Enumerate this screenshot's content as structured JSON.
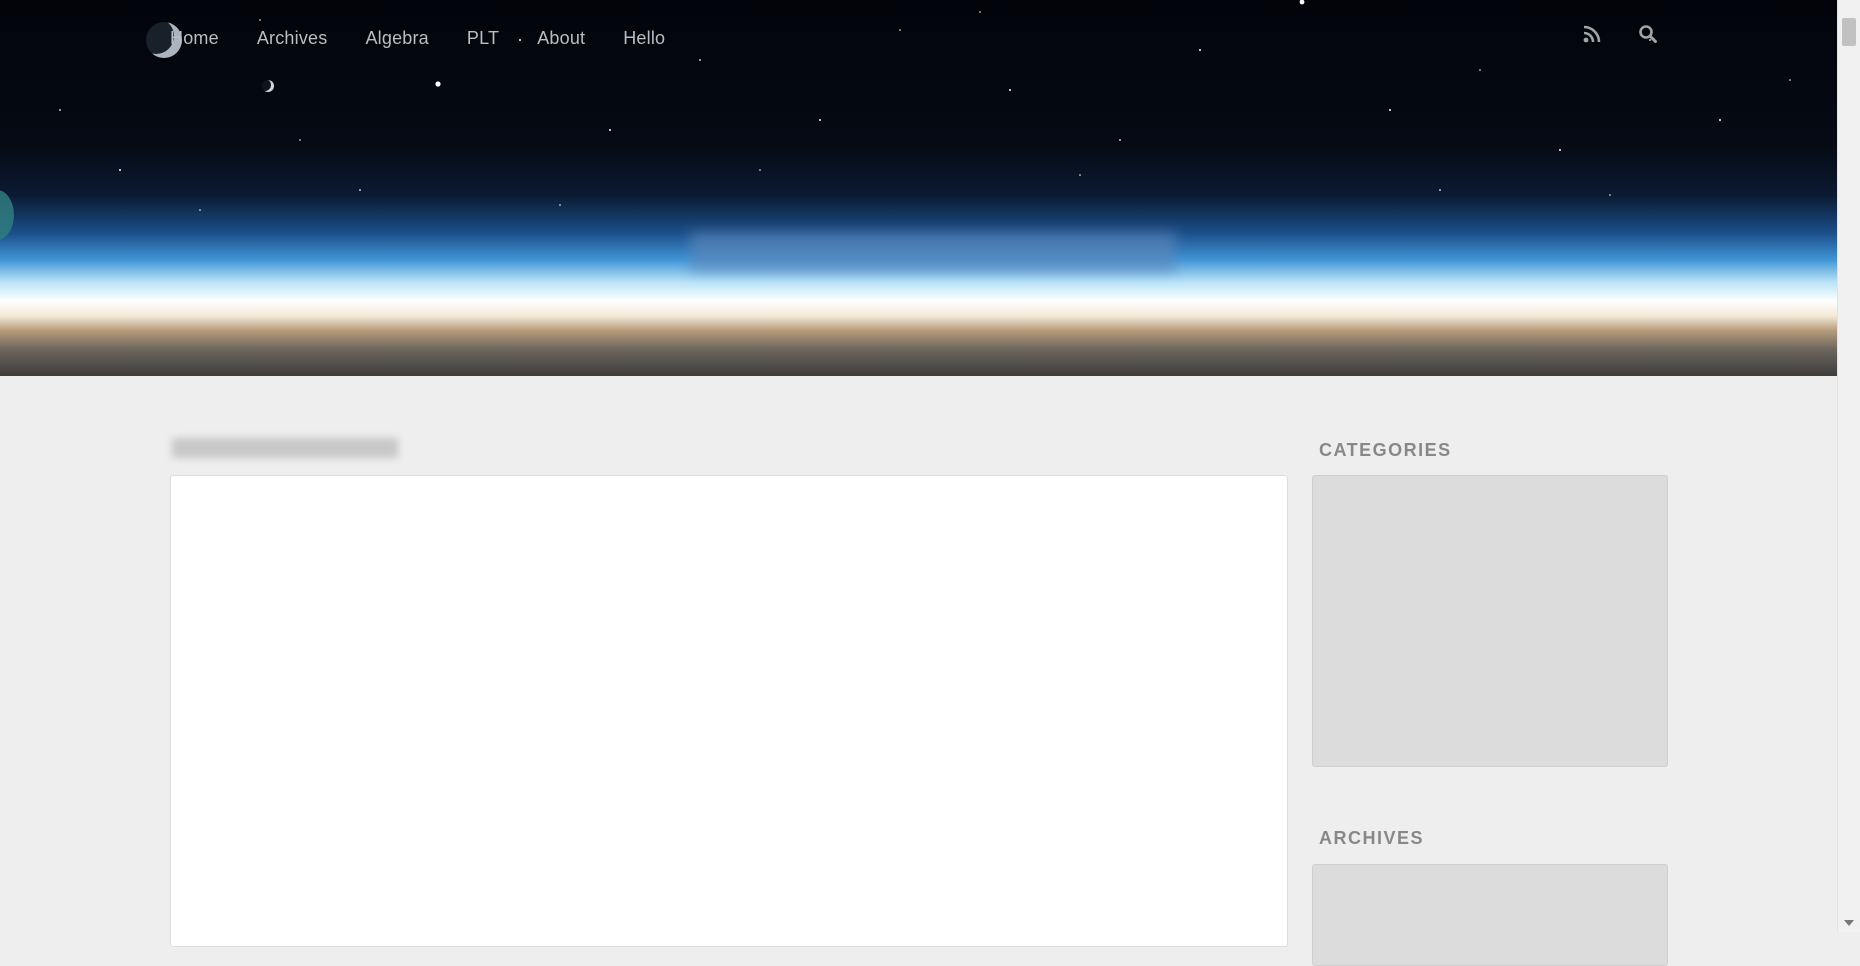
{
  "nav": {
    "items": [
      "Home",
      "Archives",
      "Algebra",
      "PLT",
      "About",
      "Hello"
    ]
  },
  "header": {
    "icons": [
      "rss-icon",
      "search-icon"
    ],
    "site_title": "",
    "site_subtitle": ""
  },
  "post": {
    "meta": "",
    "title": "",
    "subtitle": "",
    "paragraphs": [
      "",
      ""
    ]
  },
  "sidebar": {
    "categories_title": "CATEGORIES",
    "categories": [
      "",
      "",
      "",
      "",
      "",
      "",
      "",
      "",
      "",
      ""
    ],
    "archives_title": "ARCHIVES",
    "archives": [
      "",
      ""
    ]
  },
  "colors": {
    "background": "#eeeeee",
    "nav_text": "#b9bec4",
    "widget_title": "#888888",
    "link": "#5ea7d6"
  }
}
